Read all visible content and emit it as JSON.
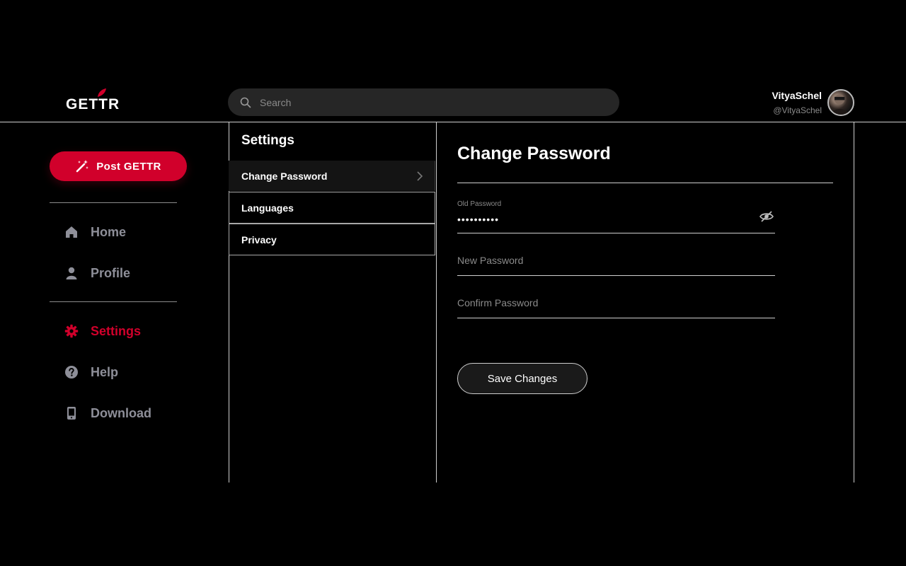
{
  "header": {
    "logo_text": "GETTR",
    "search_placeholder": "Search",
    "user": {
      "name": "VityaSchel",
      "handle": "@VityaSchel"
    }
  },
  "sidebar": {
    "post_button_label": "Post GETTR",
    "items": [
      {
        "label": "Home",
        "icon": "home-icon",
        "active": false
      },
      {
        "label": "Profile",
        "icon": "user-icon",
        "active": false
      },
      {
        "label": "Settings",
        "icon": "gear-icon",
        "active": true
      },
      {
        "label": "Help",
        "icon": "question-icon",
        "active": false
      },
      {
        "label": "Download",
        "icon": "phone-icon",
        "active": false
      }
    ]
  },
  "settings_menu": {
    "title": "Settings",
    "items": [
      {
        "label": "Change Password",
        "active": true
      },
      {
        "label": "Languages",
        "active": false
      },
      {
        "label": "Privacy",
        "active": false
      }
    ]
  },
  "content": {
    "title": "Change Password",
    "old_password": {
      "label": "Old Password",
      "value": "••••••••••"
    },
    "new_password": {
      "placeholder": "New Password"
    },
    "confirm_password": {
      "placeholder": "Confirm Password"
    },
    "save_button_label": "Save Changes"
  },
  "colors": {
    "background": "#000000",
    "accent_red": "#d1002b",
    "muted_text": "#8e8f99",
    "divider": "#cfcfcf"
  }
}
